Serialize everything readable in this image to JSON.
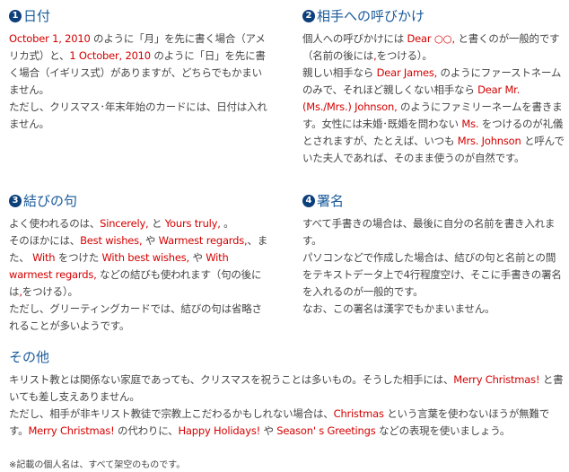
{
  "colors": {
    "heading": "#1a5a9a",
    "number_badge": "#0d3f7a",
    "highlight": "#d40000",
    "text": "#444444"
  },
  "sections": [
    {
      "number": "1",
      "heading": "日付",
      "paragraphs": [
        [
          {
            "t": "October 1, 2010",
            "red": true
          },
          {
            "t": " のように「月」を先に書く場合（アメリカ式）と、"
          },
          {
            "t": "1 October, 2010",
            "red": true
          },
          {
            "t": " のように「日」を先に書く場合（イギリス式）がありますが、どちらでもかまいません。"
          }
        ],
        [
          {
            "t": "ただし、クリスマス･年末年始のカードには、日付は入れません。"
          }
        ]
      ]
    },
    {
      "number": "2",
      "heading": "相手への呼びかけ",
      "paragraphs": [
        [
          {
            "t": "個人への呼びかけには "
          },
          {
            "t": "Dear ○○,",
            "red": true
          },
          {
            "t": " と書くのが一般的です（名前の後には"
          },
          {
            "t": ",",
            "red": true
          },
          {
            "t": "をつける）。"
          }
        ],
        [
          {
            "t": "親しい相手なら "
          },
          {
            "t": "Dear James,",
            "red": true
          },
          {
            "t": " のようにファーストネームのみで、それほど親しくない相手なら "
          },
          {
            "t": "Dear Mr.(Ms./Mrs.) Johnson,",
            "red": true
          },
          {
            "t": " のようにファミリーネームを書きます。女性には未婚･既婚を問わない "
          },
          {
            "t": "Ms.",
            "red": true
          },
          {
            "t": " をつけるのが礼儀とされますが、たとえば、いつも "
          },
          {
            "t": "Mrs. Johnson",
            "red": true
          },
          {
            "t": " と呼んでいた夫人であれば、そのまま使うのが自然です。"
          }
        ]
      ]
    },
    {
      "number": "3",
      "heading": "結びの句",
      "paragraphs": [
        [
          {
            "t": "よく使われるのは、"
          },
          {
            "t": "Sincerely,",
            "red": true
          },
          {
            "t": " と "
          },
          {
            "t": "Yours truly,",
            "red": true
          },
          {
            "t": " 。"
          }
        ],
        [
          {
            "t": "そのほかには、"
          },
          {
            "t": "Best wishes,",
            "red": true
          },
          {
            "t": " や "
          },
          {
            "t": "Warmest regards,",
            "red": true
          },
          {
            "t": "、また、 "
          },
          {
            "t": "With",
            "red": true
          },
          {
            "t": " をつけた "
          },
          {
            "t": "With best wishes,",
            "red": true
          },
          {
            "t": " や "
          },
          {
            "t": "With warmest regards,",
            "red": true
          },
          {
            "t": " などの結びも使われます（句の後には"
          },
          {
            "t": ",",
            "red": true
          },
          {
            "t": "をつける）。"
          }
        ],
        [
          {
            "t": "ただし、グリーティングカードでは、結びの句は省略されることが多いようです。"
          }
        ]
      ]
    },
    {
      "number": "4",
      "heading": "署名",
      "paragraphs": [
        [
          {
            "t": "すべて手書きの場合は、最後に自分の名前を書き入れます。"
          }
        ],
        [
          {
            "t": "パソコンなどで作成した場合は、結びの句と名前との間をテキストデータ上で4行程度空け、そこに手書きの署名を入れるのが一般的です。"
          }
        ],
        [
          {
            "t": "なお、この署名は漢字でもかまいません。"
          }
        ]
      ]
    },
    {
      "number": "",
      "heading": "その他",
      "paragraphs": [
        [
          {
            "t": "キリスト教とは関係ない家庭であっても、クリスマスを祝うことは多いもの。そうした相手には、"
          },
          {
            "t": "Merry Christmas!",
            "red": true
          },
          {
            "t": " と書いても差し支えありません。"
          }
        ],
        [
          {
            "t": "ただし、相手が非キリスト教徒で宗教上こだわるかもしれない場合は、"
          },
          {
            "t": "Christmas",
            "red": true
          },
          {
            "t": " という言葉を使わないほうが無難です。"
          },
          {
            "t": "Merry Christmas!",
            "red": true
          },
          {
            "t": " の代わりに、"
          },
          {
            "t": "Happy Holidays!",
            "red": true
          },
          {
            "t": " や "
          },
          {
            "t": "Season' s Greetings",
            "red": true
          },
          {
            "t": " などの表現を使いましょう。"
          }
        ]
      ]
    }
  ],
  "footnote": "※記載の個人名は、すべて架空のものです。"
}
